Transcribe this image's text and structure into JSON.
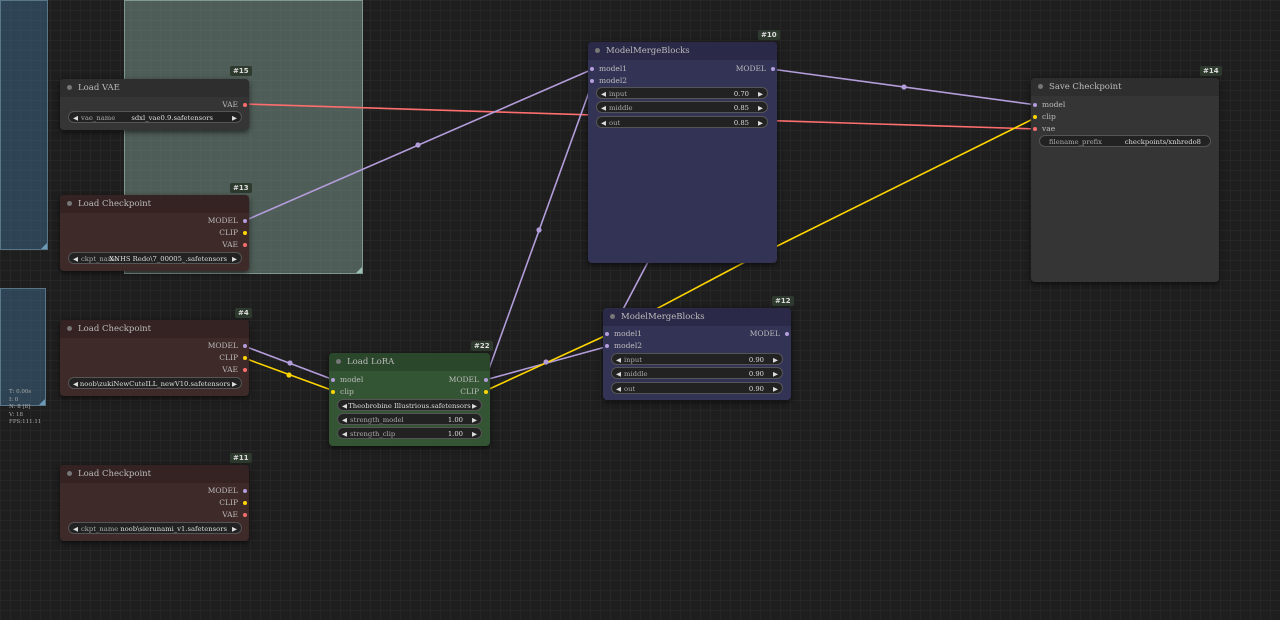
{
  "canvas": {
    "colors": {
      "model": "#b39ddb",
      "clip": "#ffd500",
      "vae": "#ff6e6e"
    },
    "stats": {
      "t": "T: 0.00s",
      "i": "I: 0",
      "n": "N: 8 [8]",
      "v": "V: 18",
      "fps": "FPS:111.11"
    }
  },
  "nodes": {
    "load_vae": {
      "id": "#15",
      "title": "Load VAE",
      "out_vae": "VAE",
      "w_label": "vae_name",
      "w_value": "sdxl_vae0.9.safetensors"
    },
    "ckpt13": {
      "id": "#13",
      "title": "Load Checkpoint",
      "out_model": "MODEL",
      "out_clip": "CLIP",
      "out_vae": "VAE",
      "w_label": "ckpt_name",
      "w_value": "XNHS Redo\\7_00005_.safetensors"
    },
    "ckpt4": {
      "id": "#4",
      "title": "Load Checkpoint",
      "out_model": "MODEL",
      "out_clip": "CLIP",
      "out_vae": "VAE",
      "w_value": "noob\\zukiNewCuteILL_newV10.safetensors"
    },
    "ckpt11": {
      "id": "#11",
      "title": "Load Checkpoint",
      "out_model": "MODEL",
      "out_clip": "CLIP",
      "out_vae": "VAE",
      "w_label": "ckpt_name",
      "w_value": "noob\\sierunami_v1.safetensors"
    },
    "lora": {
      "id": "#22",
      "title": "Load LoRA",
      "in_model": "model",
      "in_clip": "clip",
      "out_model": "MODEL",
      "out_clip": "CLIP",
      "w_lora": "Theobrobine Illustrious.safetensors",
      "w_sm_label": "strength_model",
      "w_sm_value": "1.00",
      "w_sc_label": "strength_clip",
      "w_sc_value": "1.00"
    },
    "merge10": {
      "id": "#10",
      "title": "ModelMergeBlocks",
      "in1": "model1",
      "in2": "model2",
      "out": "MODEL",
      "input_label": "input",
      "input_value": "0.70",
      "middle_label": "middle",
      "middle_value": "0.85",
      "out_label": "out",
      "out_value": "0.85"
    },
    "merge12": {
      "id": "#12",
      "title": "ModelMergeBlocks",
      "in1": "model1",
      "in2": "model2",
      "out": "MODEL",
      "input_label": "input",
      "input_value": "0.90",
      "middle_label": "middle",
      "middle_value": "0.90",
      "out_label": "out",
      "out_value": "0.90"
    },
    "save": {
      "id": "#14",
      "title": "Save Checkpoint",
      "in_model": "model",
      "in_clip": "clip",
      "in_vae": "vae",
      "w_label": "filename_prefix",
      "w_value": "checkpoints/xnhredo8"
    }
  }
}
